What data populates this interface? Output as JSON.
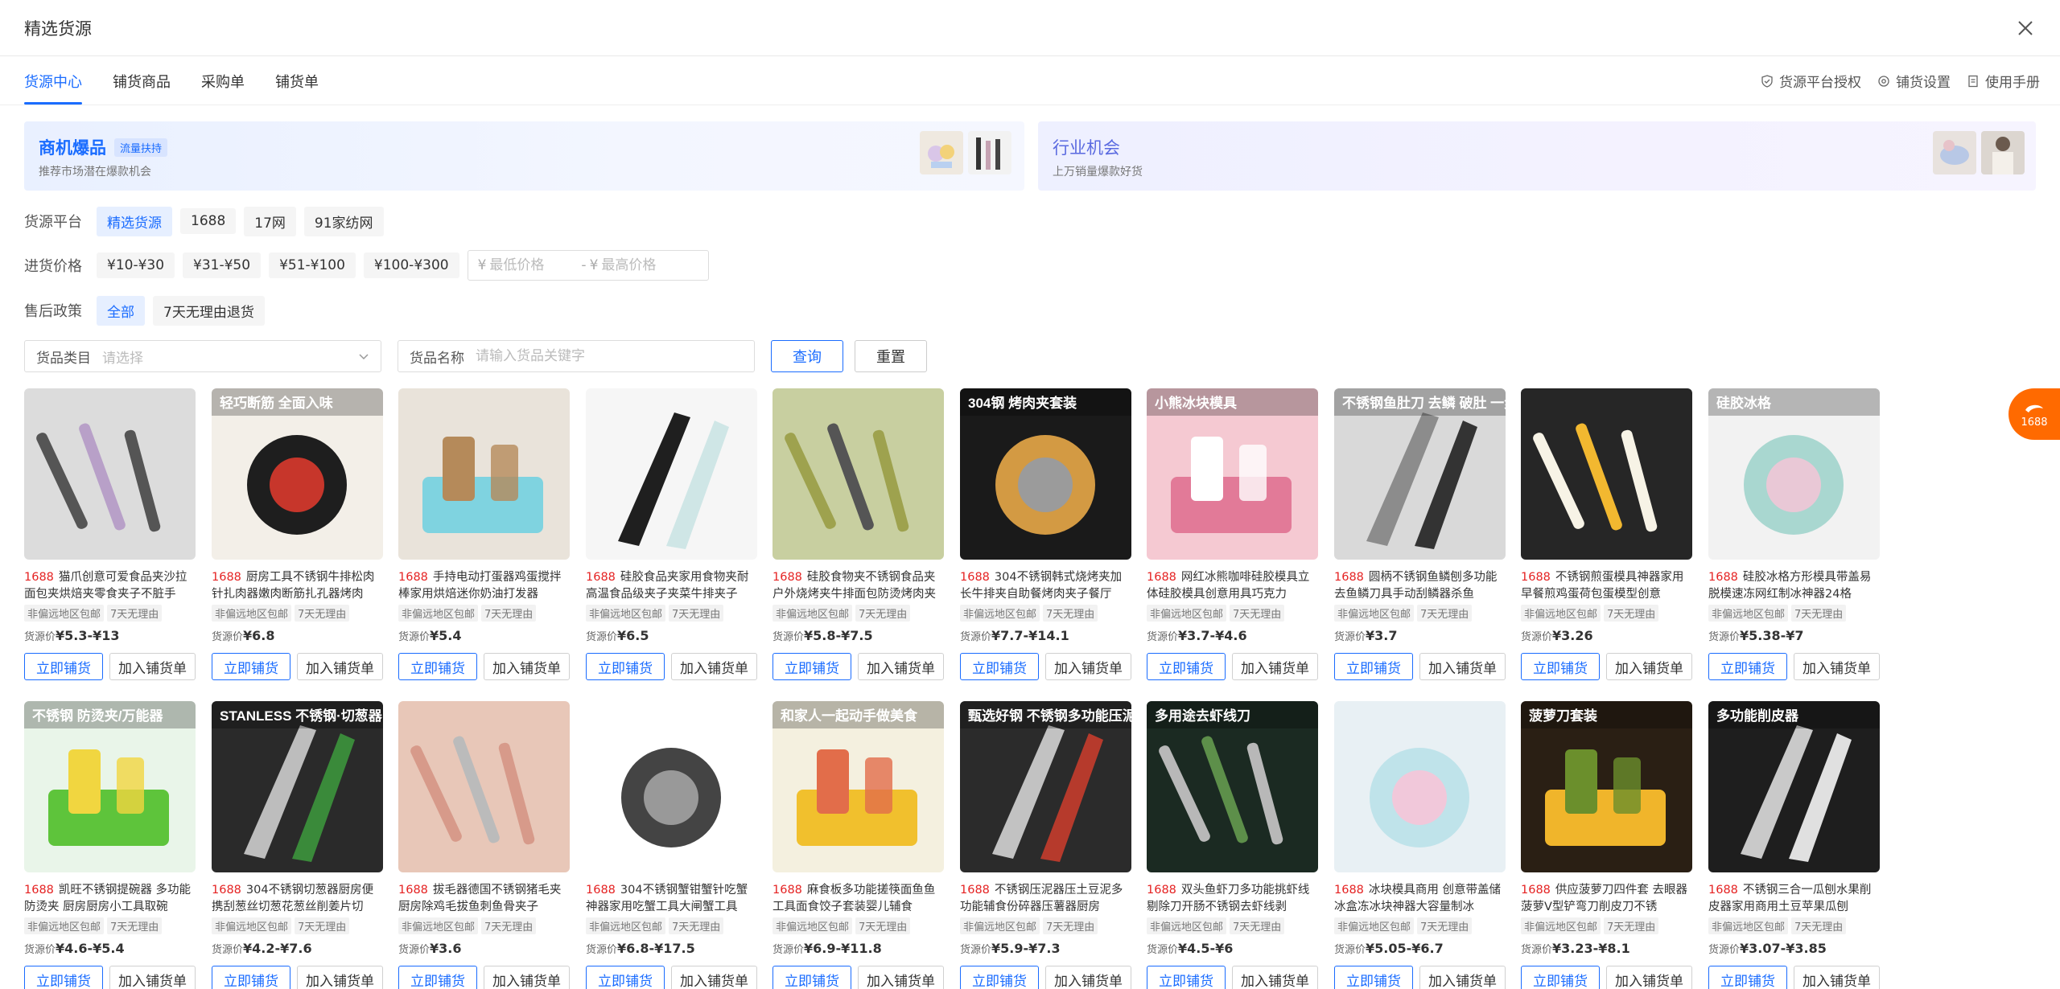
{
  "dialog": {
    "title": "精选货源"
  },
  "tabs": [
    {
      "label": "货源中心",
      "active": true
    },
    {
      "label": "铺货商品",
      "active": false
    },
    {
      "label": "采购单",
      "active": false
    },
    {
      "label": "铺货单",
      "active": false
    }
  ],
  "top_links": [
    {
      "label": "货源平台授权",
      "icon": "shield-check-icon"
    },
    {
      "label": "铺货设置",
      "icon": "gear-icon"
    },
    {
      "label": "使用手册",
      "icon": "document-icon"
    }
  ],
  "banners": [
    {
      "title": "商机爆品",
      "tag": "流量扶持",
      "subtitle": "推荐市场潜在爆款机会"
    },
    {
      "title": "行业机会",
      "tag": "",
      "subtitle": "上万销量爆款好货"
    }
  ],
  "filters": {
    "platform": {
      "label": "货源平台",
      "options": [
        "精选货源",
        "1688",
        "17网",
        "91家纺网"
      ],
      "selected": "精选货源"
    },
    "price": {
      "label": "进货价格",
      "options": [
        "¥10-¥30",
        "¥31-¥50",
        "¥51-¥100",
        "¥100-¥300"
      ],
      "currency": "¥",
      "min_placeholder": "最低价格",
      "separator": "-",
      "max_placeholder": "最高价格"
    },
    "after_sale": {
      "label": "售后政策",
      "options": [
        "全部",
        "7天无理由退货"
      ],
      "selected": "全部"
    }
  },
  "search": {
    "category_label": "货品类目",
    "category_placeholder": "请选择",
    "name_label": "货品名称",
    "name_placeholder": "请输入货品关键字",
    "query_button": "查询",
    "reset_button": "重置"
  },
  "card_common": {
    "source": "1688",
    "tag1": "非偏远地区包邮",
    "tag2": "7天无理由",
    "price_label": "货源价",
    "primary_action": "立即铺货",
    "secondary_action": "加入铺货单"
  },
  "products": [
    {
      "name": "猫爪创意可爱食品夹沙拉面包夹烘焙夹零食夹子不脏手",
      "price": "¥5.3-¥13",
      "image": "food-tongs-set"
    },
    {
      "name": "厨房工具不锈钢牛排松肉针扎肉器嫩肉断筋扎孔器烤肉",
      "price": "¥6.8",
      "image": "meat-tenderizer",
      "overlay": "轻巧断筋 全面入味"
    },
    {
      "name": "手持电动打蛋器鸡蛋搅拌棒家用烘焙迷你奶油打发器",
      "price": "¥5.4",
      "image": "electric-whisk"
    },
    {
      "name": "硅胶食品夹家用食物夹耐高温食品级夹子夹菜牛排夹子",
      "price": "¥6.5",
      "image": "silicone-tongs"
    },
    {
      "name": "硅胶食物夹不锈钢食品夹户外烧烤夹牛排面包防烫烤肉夹",
      "price": "¥5.8-¥7.5",
      "image": "silicone-bbq-tongs"
    },
    {
      "name": "304不锈钢韩式烧烤夹加长牛排夹自助餐烤肉夹子餐厅",
      "price": "¥7.7-¥14.1",
      "image": "korean-bbq-scissors",
      "overlay": "304钢 烤肉夹套装"
    },
    {
      "name": "网红冰熊咖啡硅胶模具立体硅胶模具创意用具巧克力",
      "price": "¥3.7-¥4.6",
      "image": "bear-ice-mold",
      "overlay": "小熊冰块模具"
    },
    {
      "name": "圆柄不锈钢鱼鳞刨多功能去鱼鳞刀具手动刮鳞器杀鱼",
      "price": "¥3.7",
      "image": "fish-scaler",
      "overlay": "不锈钢鱼肚刀 去鳞 破肚 一步到位"
    },
    {
      "name": "不锈钢煎蛋模具神器家用早餐煎鸡蛋荷包蛋模型创意",
      "price": "¥3.26",
      "image": "egg-mold"
    },
    {
      "name": "硅胶冰格方形模具带盖易脱模速冻网红制冰神器24格",
      "price": "¥5.38-¥7",
      "image": "ice-tray",
      "overlay": "硅胶冰格"
    },
    {
      "name": "凯旺不锈钢提碗器 多功能防烫夹 厨房厨房小工具取碗",
      "price": "¥4.6-¥5.4",
      "image": "bowl-clip",
      "overlay": "不锈钢 防烫夹/万能器"
    },
    {
      "name": "304不锈钢切葱器厨房便携刮葱丝切葱花葱丝削姜片切",
      "price": "¥4.2-¥7.6",
      "image": "scallion-cutter",
      "overlay": "STANLESS 不锈钢·切葱器"
    },
    {
      "name": "拔毛器德国不锈钢猪毛夹厨房除鸡毛拔鱼刺鱼骨夹子",
      "price": "¥3.6",
      "image": "hair-tweezer"
    },
    {
      "name": "304不锈钢蟹钳蟹针吃蟹神器家用吃蟹工具大闸蟹工具",
      "price": "¥6.8-¥17.5",
      "image": "crab-cracker"
    },
    {
      "name": "麻食板多功能搓筷面鱼鱼工具面食饺子套装婴儿辅食",
      "price": "¥6.9-¥11.8",
      "image": "pasta-board",
      "overlay": "和家人一起动手做美食"
    },
    {
      "name": "不锈钢压泥器压土豆泥多功能辅食份碎器压薯器厨房",
      "price": "¥5.9-¥7.3",
      "image": "potato-masher",
      "overlay": "甄选好钢 不锈钢多功能压泥器"
    },
    {
      "name": "双头鱼虾刀多功能挑虾线剔除刀开肠不锈钢去虾线剥",
      "price": "¥4.5-¥6",
      "image": "shrimp-knife",
      "overlay": "多用途去虾线刀"
    },
    {
      "name": "冰块模具商用 创意带盖储冰盒冻冰块神器大容量制冰",
      "price": "¥5.05-¥6.7",
      "image": "ice-box"
    },
    {
      "name": "供应菠萝刀四件套 去眼器菠萝V型铲弯刀削皮刀不锈",
      "price": "¥3.23-¥8.1",
      "image": "pineapple-knife",
      "overlay": "菠萝刀套装"
    },
    {
      "name": "不锈钢三合一瓜刨水果削皮器家用商用土豆苹果瓜刨",
      "price": "¥3.07-¥3.85",
      "image": "peeler",
      "overlay": "多功能削皮器"
    }
  ],
  "float_widget": {
    "label": "1688"
  }
}
